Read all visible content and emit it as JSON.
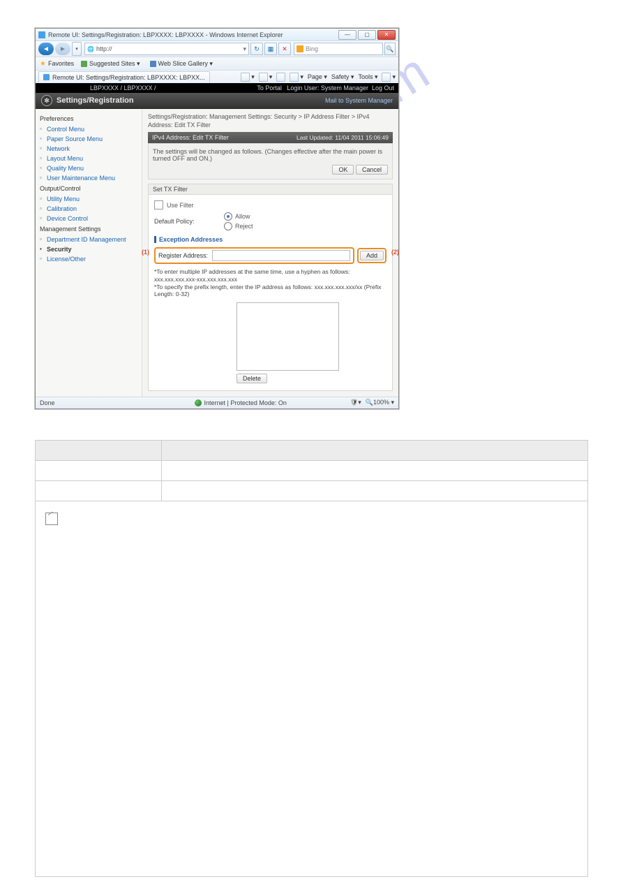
{
  "window": {
    "title": "Remote UI: Settings/Registration: LBPXXXX: LBPXXXX - Windows Internet Explorer",
    "url_scheme": "http://",
    "search_engine": "Bing",
    "min_label": "—",
    "max_label": "▢",
    "close_label": "✕"
  },
  "favbar": {
    "label": "Favorites",
    "suggested": "Suggested Sites ▾",
    "webslice": "Web Slice Gallery ▾"
  },
  "tab": {
    "label": "Remote UI: Settings/Registration: LBPXXXX: LBPXX..."
  },
  "cmdbar": {
    "page": "Page ▾",
    "safety": "Safety ▾",
    "tools": "Tools ▾"
  },
  "appbar": {
    "model": "LBPXXXX / LBPXXXX /",
    "portal": "To Portal",
    "login_user": "Login User:",
    "user": "System Manager",
    "logout": "Log Out"
  },
  "apphead": {
    "title": "Settings/Registration",
    "mail": "Mail to System Manager"
  },
  "side": {
    "s1": "Preferences",
    "s1i": [
      "Control Menu",
      "Paper Source Menu",
      "Network",
      "Layout Menu",
      "Quality Menu",
      "User Maintenance Menu"
    ],
    "s2": "Output/Control",
    "s2i": [
      "Utility Menu",
      "Calibration",
      "Device Control"
    ],
    "s3": "Management Settings",
    "s3i": [
      "Department ID Management",
      "Security",
      "License/Other"
    ]
  },
  "crumb": "Settings/Registration: Management Settings: Security > IP Address Filter > IPv4 Address: Edit TX Filter",
  "panel": {
    "title": "IPv4 Address: Edit TX Filter",
    "stamp": "Last Updated: 11/04 2011 15:06:49"
  },
  "info": "The settings will be changed as follows. (Changes effective after the main power is turned OFF and ON.)",
  "btn_ok": "OK",
  "btn_cancel": "Cancel",
  "sec_title": "Set TX Filter",
  "use_filter": "Use Filter",
  "def_policy": "Default Policy:",
  "allow": "Allow",
  "reject": "Reject",
  "exc_title": "Exception Addresses",
  "reg_label": "Register Address:",
  "btn_add": "Add",
  "call1": "(1)",
  "call2": "(2)",
  "hint": "*To enter multiple IP addresses at the same time, use a hyphen as follows: xxx.xxx.xxx.xxx-xxx.xxx.xxx.xxx\n*To specify the prefix length, enter the IP address as follows: xxx.xxx.xxx.xxx/xx (Prefix Length: 0-32)",
  "btn_delete": "Delete",
  "status": {
    "done": "Done",
    "zone": "Internet | Protected Mode: On",
    "zoom": "100%"
  },
  "table": {
    "h1": "",
    "h2": "",
    "r1c1": "",
    "r1c2": "",
    "r2c1": "",
    "r2c2": ""
  }
}
